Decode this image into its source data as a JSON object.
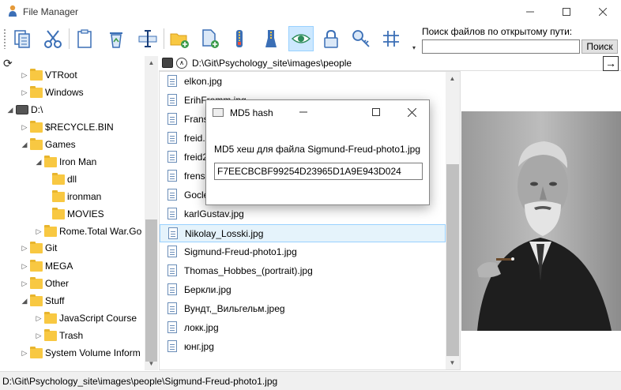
{
  "window": {
    "title": "File Manager"
  },
  "toolbar": {
    "overflow_glyph": "▾"
  },
  "search": {
    "label": "Поиск файлов по открытому пути:",
    "value": "",
    "button": "Поиск"
  },
  "address": {
    "path": "D:\\Git\\Psychology_site\\images\\people",
    "up_glyph": "∧",
    "go_glyph": "→"
  },
  "tree": {
    "refresh_glyph": "⟳",
    "items": [
      {
        "label": "VTRoot"
      },
      {
        "label": "Windows"
      },
      {
        "label": "D:\\"
      },
      {
        "label": "$RECYCLE.BIN"
      },
      {
        "label": "Games"
      },
      {
        "label": "Iron Man"
      },
      {
        "label": "dll"
      },
      {
        "label": "ironman"
      },
      {
        "label": "MOVIES"
      },
      {
        "label": "Rome.Total War.Go"
      },
      {
        "label": "Git"
      },
      {
        "label": "MEGA"
      },
      {
        "label": "Other"
      },
      {
        "label": "Stuff"
      },
      {
        "label": "JavaScript Course"
      },
      {
        "label": "Trash"
      },
      {
        "label": "System Volume Inform"
      }
    ]
  },
  "files": [
    {
      "name": "elkon.jpg"
    },
    {
      "name": "ErihFromm.jpg"
    },
    {
      "name": "Frans"
    },
    {
      "name": "freid."
    },
    {
      "name": "freid2"
    },
    {
      "name": "frens"
    },
    {
      "name": "Gocle"
    },
    {
      "name": "karlGustav.jpg"
    },
    {
      "name": "Nikolay_Losski.jpg"
    },
    {
      "name": "Sigmund-Freud-photo1.jpg"
    },
    {
      "name": "Thomas_Hobbes_(portrait).jpg"
    },
    {
      "name": "Беркли.jpg"
    },
    {
      "name": "Вундт,_Вильгельм.jpeg"
    },
    {
      "name": "локк.jpg"
    },
    {
      "name": "юнг.jpg"
    }
  ],
  "dialog": {
    "title": "MD5 hash",
    "message": "MD5 хеш для файла Sigmund-Freud-photo1.jpg",
    "hash": "F7EECBCBF99254D23965D1A9E943D024"
  },
  "status": {
    "path": "D:\\Git\\Psychology_site\\images\\people\\Sigmund-Freud-photo1.jpg"
  },
  "colors": {
    "accent": "#cce8ff",
    "selection": "#e5f3fb",
    "folder": "#f8c842"
  }
}
